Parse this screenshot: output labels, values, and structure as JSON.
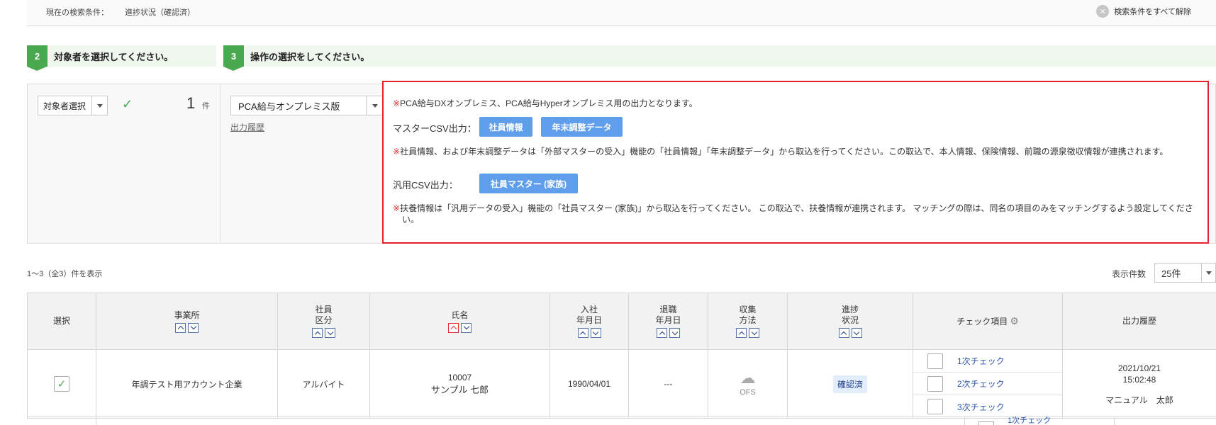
{
  "search": {
    "label": "現在の検索条件：",
    "value": "進捗状況（確認済）",
    "clear_all": "検索条件をすべて解除"
  },
  "steps": [
    {
      "num": "2",
      "title": "対象者を選択してください。"
    },
    {
      "num": "3",
      "title": "操作の選択をしてください。"
    }
  ],
  "target": {
    "select_label": "対象者選択",
    "count": "1",
    "count_unit": "件"
  },
  "operation": {
    "selected": "PCA給与オンプレミス版",
    "history_link": "出力履歴"
  },
  "info": {
    "note_mark": "※",
    "note1": "PCA給与DXオンプレミス、PCA給与Hyperオンプレミス用の出力となります。",
    "master_csv_label": "マスターCSV出力：",
    "btn_employee": "社員情報",
    "btn_year_end": "年末調整データ",
    "note2": "社員情報、および年末調整データは「外部マスターの受入」機能の「社員情報」「年末調整データ」から取込を行ってください。この取込で、本人情報、保険情報、前職の源泉徴収情報が連携されます。",
    "generic_csv_label": "汎用CSV出力：",
    "btn_family": "社員マスター (家族)",
    "note3": "扶養情報は「汎用データの受入」機能の「社員マスター (家族)」から取込を行ってください。 この取込で、扶養情報が連携されます。 マッチングの際は、同名の項目のみをマッチングするよう設定してください。"
  },
  "list": {
    "count_text": "1〜3（全3）件を表示",
    "per_page_label": "表示件数",
    "per_page": "25件"
  },
  "table": {
    "headers": {
      "select": "選択",
      "office": "事業所",
      "emp_type": "社員\n区分",
      "name": "氏名",
      "hire_date": "入社\n年月日",
      "retire_date": "退職\n年月日",
      "collect": "収集\n方法",
      "progress": "進捗\n状況",
      "check_items": "チェック項目",
      "history": "出力履歴"
    },
    "rows": [
      {
        "checked": "✓",
        "office": "年調テスト用アカウント企業",
        "emp_type": "アルバイト",
        "emp_no": "10007",
        "name": "サンプル 七郎",
        "hire_date": "1990/04/01",
        "retire_date": "---",
        "collect": "OFS",
        "status": "確認済",
        "checks": [
          "1次チェック",
          "2次チェック",
          "3次チェック"
        ],
        "history_date": "2021/10/21",
        "history_time": "15:02:48",
        "history_user": "マニュアル　太郎"
      }
    ],
    "next_row_partial_check": "1次チェック"
  },
  "icons": {
    "clear": "close-circle-icon",
    "check": "checkmark-icon",
    "cloud": "cloud-icon",
    "gear": "gear-icon"
  },
  "colors": {
    "accent_green": "#4aa84f",
    "button_blue": "#5e9eea",
    "highlight_red": "#e8202a",
    "link_blue": "#2b56b0"
  }
}
